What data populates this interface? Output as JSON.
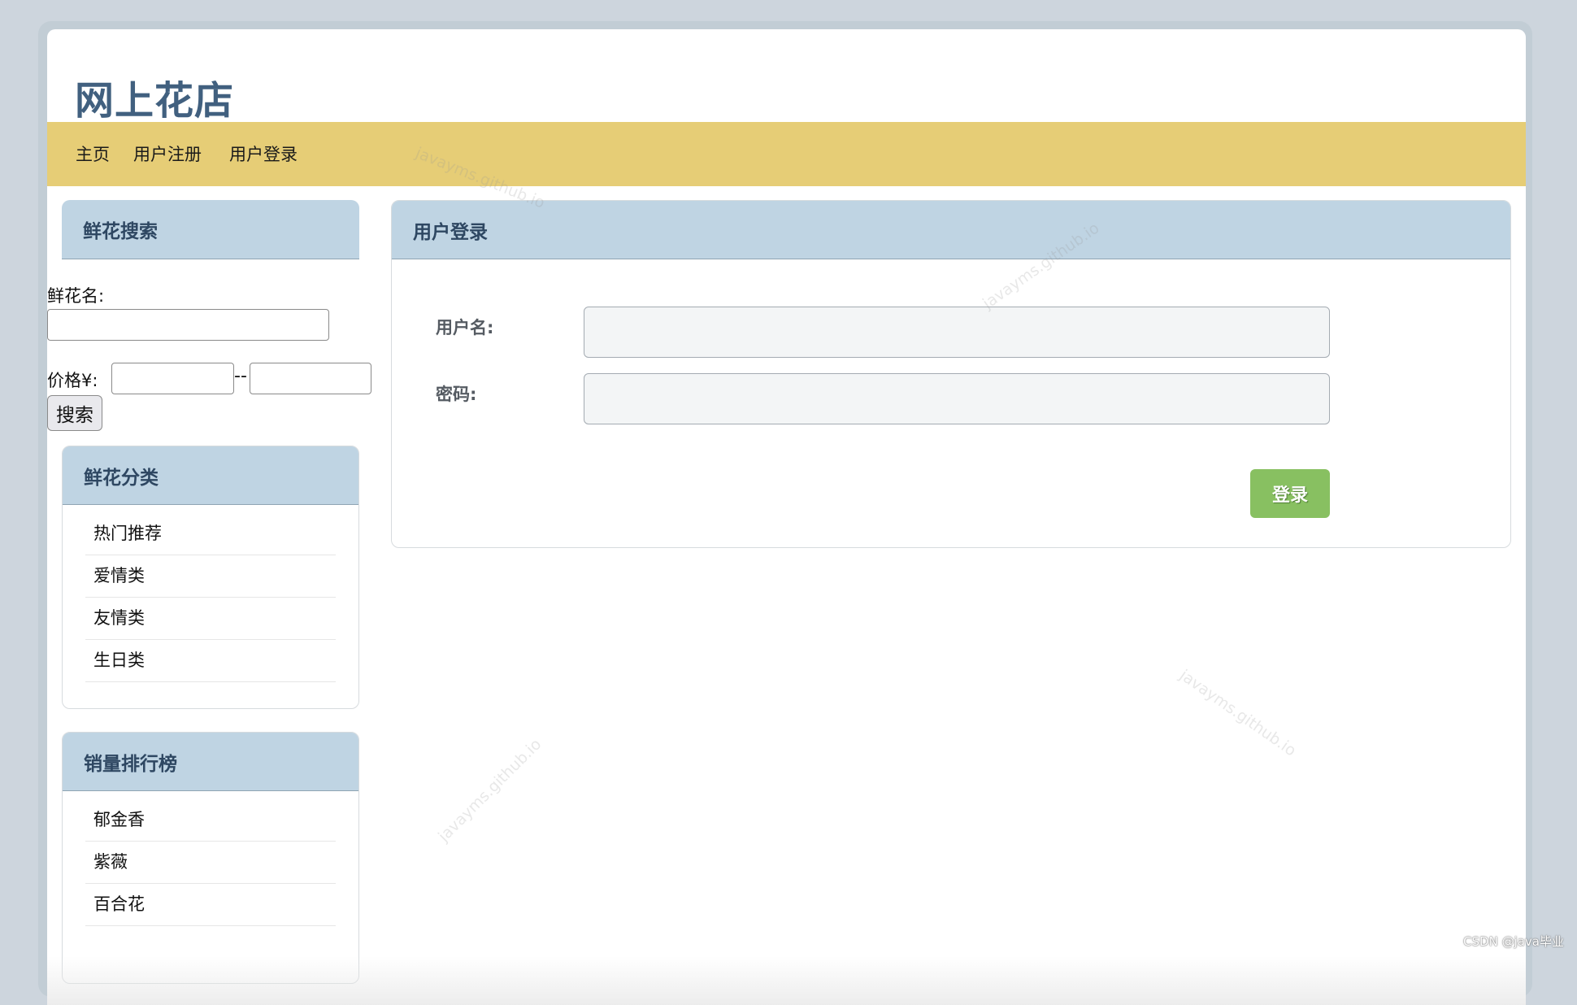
{
  "site": {
    "title": "网上花店"
  },
  "nav": {
    "items": [
      {
        "label": "主页"
      },
      {
        "label": "用户注册"
      },
      {
        "label": "用户登录"
      }
    ]
  },
  "search": {
    "title": "鲜花搜索",
    "name_label": "鲜花名:",
    "name_value": "",
    "price_label": "价格¥:",
    "price_min": "",
    "price_max": "",
    "separator": "--",
    "button_label": "搜索"
  },
  "categories": {
    "title": "鲜花分类",
    "items": [
      {
        "label": "热门推荐"
      },
      {
        "label": "爱情类"
      },
      {
        "label": "友情类"
      },
      {
        "label": "生日类"
      }
    ]
  },
  "ranking": {
    "title": "销量排行榜",
    "items": [
      {
        "label": "郁金香"
      },
      {
        "label": "紫薇"
      },
      {
        "label": "百合花"
      }
    ]
  },
  "login": {
    "title": "用户登录",
    "username_label": "用户名:",
    "username_value": "",
    "password_label": "密码:",
    "password_value": "",
    "submit_label": "登录"
  },
  "watermarks": {
    "text": "javayms.github.io",
    "credit": "CSDN @java毕业"
  },
  "colors": {
    "navbar": "#e6cd76",
    "card_header": "#bfd4e3",
    "title": "#41607f",
    "login_button": "#88c061",
    "background": "#cdd5dd"
  }
}
